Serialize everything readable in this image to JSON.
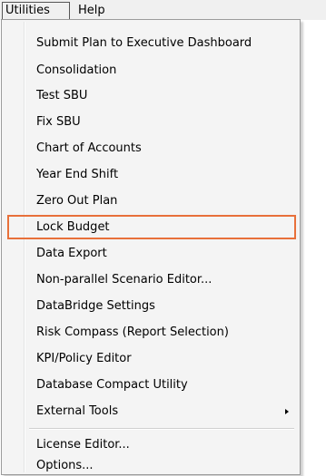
{
  "menubar": {
    "items": [
      {
        "label": "Utilities",
        "active": true
      },
      {
        "label": "Help",
        "active": false
      }
    ]
  },
  "menu": {
    "items": [
      {
        "label": "Submit Plan to Executive Dashboard"
      },
      {
        "label": "Consolidation"
      },
      {
        "label": "Test SBU"
      },
      {
        "label": "Fix SBU"
      },
      {
        "label": "Chart of Accounts"
      },
      {
        "label": "Year End Shift"
      },
      {
        "label": "Zero Out Plan"
      },
      {
        "label": "Lock Budget",
        "highlighted": true
      },
      {
        "label": "Data Export"
      },
      {
        "label": "Non-parallel Scenario Editor..."
      },
      {
        "label": "DataBridge Settings"
      },
      {
        "label": "Risk Compass (Report Selection)"
      },
      {
        "label": "KPI/Policy Editor"
      },
      {
        "label": "Database Compact Utility"
      },
      {
        "label": "External Tools",
        "has_submenu": true
      }
    ],
    "footer_items": [
      {
        "label": "License Editor..."
      },
      {
        "label": "Options..."
      }
    ]
  },
  "colors": {
    "highlight_border": "#e8703a",
    "menu_background": "#f4f4f4",
    "menubar_background": "#f0f0f0"
  }
}
